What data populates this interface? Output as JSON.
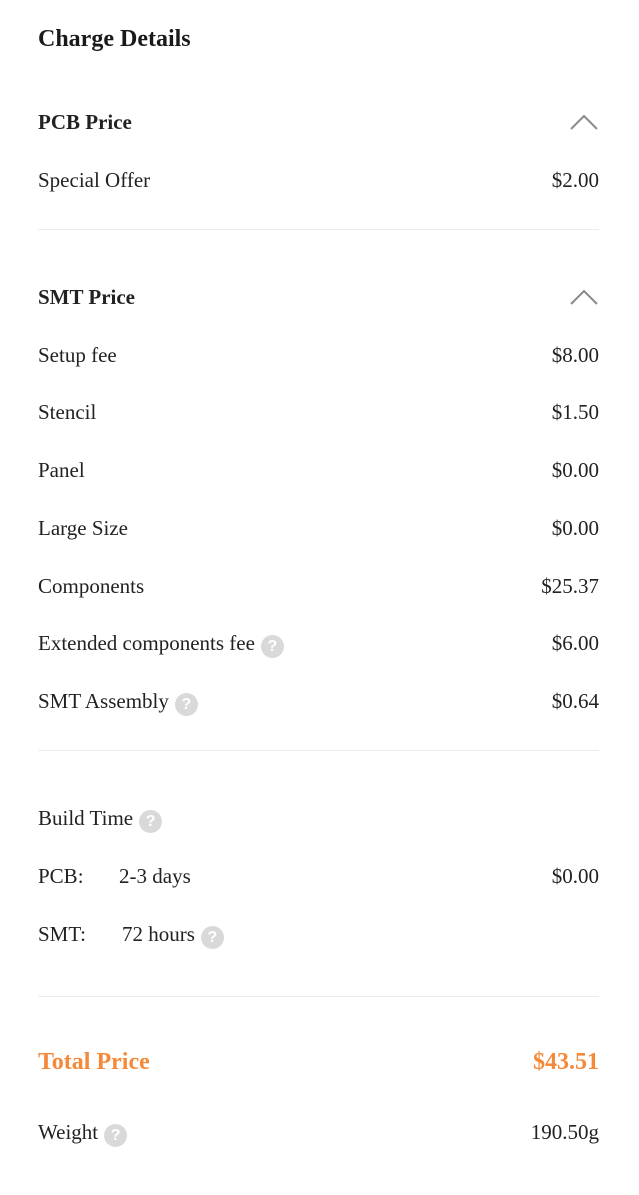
{
  "title": "Charge Details",
  "pcb": {
    "heading": "PCB Price",
    "items": [
      {
        "label": "Special Offer",
        "value": "$2.00"
      }
    ]
  },
  "smt": {
    "heading": "SMT Price",
    "items": [
      {
        "label": "Setup fee",
        "value": "$8.00"
      },
      {
        "label": "Stencil",
        "value": "$1.50"
      },
      {
        "label": "Panel",
        "value": "$0.00"
      },
      {
        "label": "Large Size",
        "value": "$0.00"
      },
      {
        "label": "Components",
        "value": "$25.37"
      },
      {
        "label": "Extended components fee",
        "value": "$6.00"
      },
      {
        "label": "SMT Assembly",
        "value": "$0.64"
      }
    ]
  },
  "build_time": {
    "label": "Build Time",
    "pcb": {
      "label": "PCB:",
      "time": "2-3 days",
      "value": "$0.00"
    },
    "smt": {
      "label": "SMT:",
      "time": "72 hours"
    }
  },
  "total": {
    "label": "Total Price",
    "value": "$43.51"
  },
  "weight": {
    "label": "Weight",
    "value": "190.50g"
  },
  "icons": {
    "help": "?",
    "collapse": "chevron-up-icon"
  },
  "colors": {
    "accent": "#f5893a",
    "text": "#222222",
    "help_icon": "#d9d9d9",
    "divider": "#ececec"
  }
}
